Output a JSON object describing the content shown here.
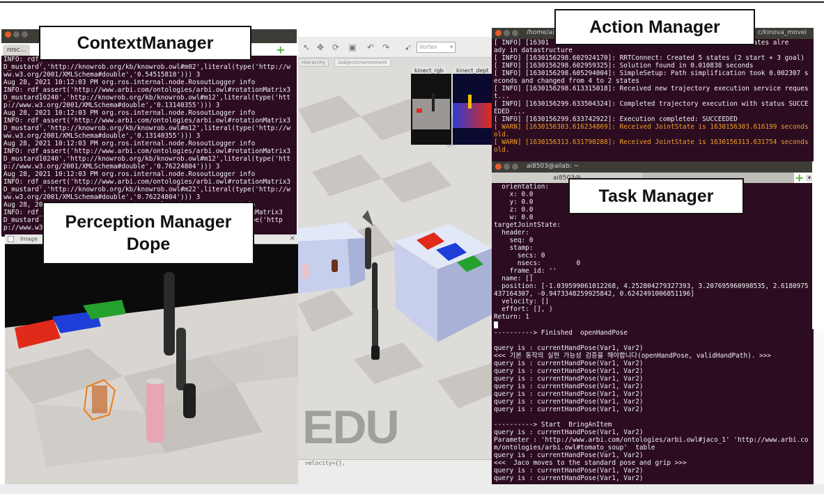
{
  "labels": {
    "context_manager": "ContextManager",
    "action_manager": "Action Manager",
    "task_manager": "Task Manager",
    "perception_manager_line1": "Perception Manager",
    "perception_manager_line2": "Dope"
  },
  "watermark": "EDU",
  "context_terminal": {
    "tab_label": "rosc...",
    "lines": [
      "INFO: rdf_",
      "D_mustard','http://knowrob.org/kb/knowrob.owl#m02',literal(type('http://w",
      "ww.w3.org/2001/XMLSchema#double','0.54515818'))) 3",
      "Aug 28, 2021 10:12:03 PM org.ros.internal.node.RosoutLogger info",
      "INFO: rdf_assert('http://www.arbi.com/ontologies/arbi.owl#rotationMatrix3",
      "D_mustard10240','http://knowrob.org/kb/knowrob.owl#m12',literal(type('htt",
      "p://www.w3.org/2001/XMLSchema#double','0.13140355'))) 3",
      "Aug 28, 2021 10:12:03 PM org.ros.internal.node.RosoutLogger info",
      "INFO: rdf_assert('http://www.arbi.com/ontologies/arbi.owl#rotationMatrix3",
      "D_mustard','http://knowrob.org/kb/knowrob.owl#m12',literal(type('http://w",
      "ww.w3.org/2001/XMLSchema#double','0.13140355'))) 3",
      "Aug 28, 2021 10:12:03 PM org.ros.internal.node.RosoutLogger info",
      "INFO: rdf_assert('http://www.arbi.com/ontologies/arbi.owl#rotationMatrix3",
      "D_mustard10240','http://knowrob.org/kb/knowrob.owl#m12',literal(type('htt",
      "p://www.w3.org/2001/XMLSchema#double','0.76224804'))) 3",
      "Aug 28, 2021 10:12:03 PM org.ros.internal.node.RosoutLogger info",
      "INFO: rdf_assert('http://www.arbi.com/ontologies/arbi.owl#rotationMatrix3",
      "D_mustard','http://knowrob.org/kb/knowrob.owl#m22',literal(type('http://w",
      "ww.w3.org/2001/XMLSchema#double','0.76224804'))) 3",
      "Aug 28, 2021 10:12:03 PM org.ros.internal.node.RosoutLogger info",
      "INFO: rdf_                                                   ionMatrix3",
      "D_mustard                                                    type('http",
      "p://www.w3"
    ]
  },
  "action_terminal": {
    "title": "/home/ai",
    "title_suffix": "c/kinova_movei",
    "lines": [
      "[ INFO] [16301                                                1 states alre",
      "ady in datastructure",
      "[ INFO] [1630156298.602924170]: RRTConnect: Created 5 states (2 start + 3 goal)",
      "[ INFO] [1630156298.602959325]: Solution found in 0.010838 seconds",
      "[ INFO] [1630156298.605294004]: SimpleSetup: Path simplification took 0.002307 s",
      "econds and changed from 4 to 2 states",
      "[ INFO] [1630156298.613315018]: Received new trajectory execution service reques",
      "t...",
      "[ INFO] [1630156299.633504324]: Completed trajectory execution with status SUCCE",
      "EDED ...",
      "[ INFO] [1630156299.633742922]: Execution completed: SUCCEEDED"
    ],
    "warn_lines": [
      "[ WARN] [1630156303.616234869]: Received JointState is 1630156303.616199 seconds",
      "old.",
      "[ WARN] [1630156313.631790288]: Received JointState is 1630156313.631754 seconds",
      "old."
    ]
  },
  "task_terminal": {
    "title": "ai8503@ailab: ~",
    "tab_left": "ai8503@",
    "tab_left2": "ai8503",
    "lines": [
      "  orientation:",
      "    x: 0.0",
      "    y: 0.0",
      "    z: 0.0",
      "    w: 0.0",
      "targetJointState:",
      "  header:",
      "    seq: 0",
      "    stamp:",
      "      secs: 0",
      "      nsecs:         0",
      "    frame_id: ''",
      "  name: []",
      "  position: [-1.039599061012268, 4.252804279327393, 3.207695960998535, 2.6180975",
      "437164307, -0.9473348259925842, 0.6242491006851196]",
      "  velocity: []",
      "  effort: [], )",
      "Return: 1"
    ]
  },
  "bottom_terminal": {
    "lines": [
      "----------> Finished  openHandPose",
      "",
      "query is : currentHandPose(Var1, Var2)",
      "<<< 기본 동작의 실현 가능성 검증을 해야합니다(openHandPose, validHandPath). >>>",
      "query is : currentHandPose(Var1, Var2)",
      "query is : currentHandPose(Var1, Var2)",
      "query is : currentHandPose(Var1, Var2)",
      "query is : currentHandPose(Var1, Var2)",
      "query is : currentHandPose(Var1, Var2)",
      "query is : currentHandPose(Var1, Var2)",
      "query is : currentHandPose(Var1, Var2)",
      "",
      "----------> Start  BringAnItem",
      "query is : currentHandPose(Var1, Var2)",
      "Parameter : 'http://www.arbi.com/ontologies/arbi.owl#jaco_1' 'http://www.arbi.co",
      "m/ontologies/arbi.owl#tomato_soup'  table",
      "query is : currentHandPose(Var1, Var2)",
      "<<<  Jaco moves to the standard pose and grip >>>",
      "query is : currentHandPose(Var1, Var2)",
      "query is : currentHandPose(Var1, Var2)"
    ]
  },
  "gazebo": {
    "tab1": "Hierarchy",
    "tab2": "3objectenvironment",
    "engine": "Vortex",
    "cam1": "kinect_rgb",
    "cam2": "kinect_dept",
    "velocity_text": "velocity={},"
  },
  "image_window": {
    "title": "Image"
  }
}
